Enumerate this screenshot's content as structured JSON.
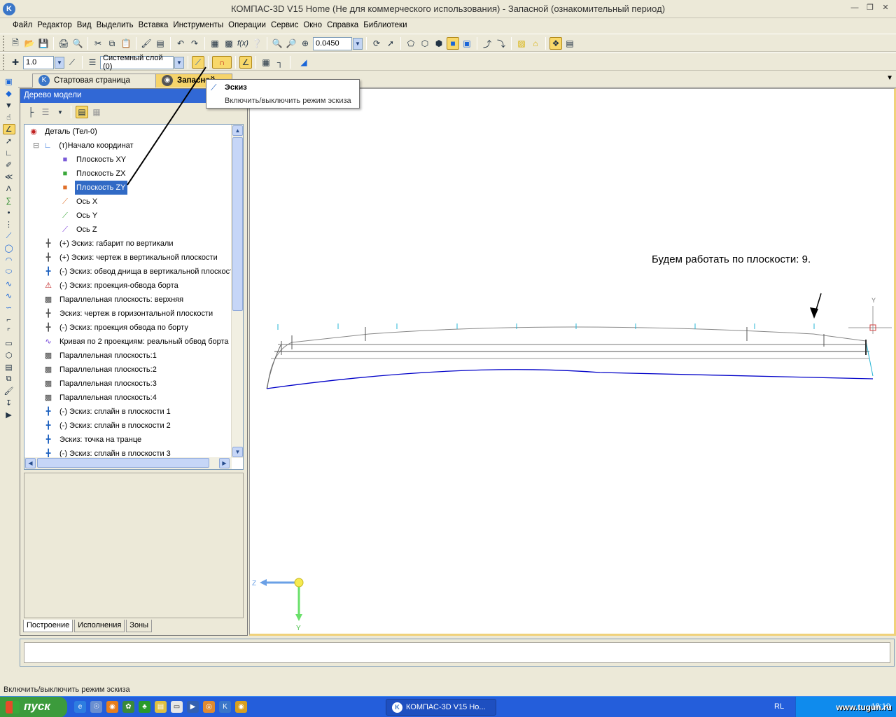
{
  "window": {
    "title": "КОМПАС-3D V15 Home (Не для коммерческого использования) - Запасной (ознакомительный период)"
  },
  "menu": [
    "Файл",
    "Редактор",
    "Вид",
    "Выделить",
    "Вставка",
    "Инструменты",
    "Операции",
    "Сервис",
    "Окно",
    "Справка",
    "Библиотеки"
  ],
  "toolbar": {
    "zoom_value": "0.0450",
    "step_value": "1.0",
    "layer_value": "Системный слой (0)"
  },
  "tabs": {
    "start_page": "Стартовая страница",
    "document": "Запасной"
  },
  "tree_panel": {
    "title": "Дерево модели",
    "rows": [
      {
        "label": "Деталь (Тел-0)",
        "indent": 0,
        "icon": "part-error-icon"
      },
      {
        "label": "(т)Начало координат",
        "indent": 1,
        "icon": "origin-icon"
      },
      {
        "label": "Плоскость XY",
        "indent": 2,
        "icon": "plane-xy-icon"
      },
      {
        "label": "Плоскость ZX",
        "indent": 2,
        "icon": "plane-zx-icon"
      },
      {
        "label": "Плоскость ZY",
        "indent": 2,
        "icon": "plane-zy-icon",
        "selected": true
      },
      {
        "label": "Ось X",
        "indent": 2,
        "icon": "axis-x-icon"
      },
      {
        "label": "Ось Y",
        "indent": 2,
        "icon": "axis-y-icon"
      },
      {
        "label": "Ось Z",
        "indent": 2,
        "icon": "axis-z-icon"
      },
      {
        "label": "(+) Эскиз: габарит по вертикали",
        "indent": 1,
        "icon": "sketch-gray-icon"
      },
      {
        "label": "(+) Эскиз: чертеж в вертикальной плоскости",
        "indent": 1,
        "icon": "sketch-gray-icon"
      },
      {
        "label": "(-) Эскиз: обвод днища в вертикальной плоскости",
        "indent": 1,
        "icon": "sketch-blue-icon"
      },
      {
        "label": "(-) Эскиз: проекция-обвода борта",
        "indent": 1,
        "icon": "sketch-error-icon"
      },
      {
        "label": "Параллельная плоскость: верхняя",
        "indent": 1,
        "icon": "plane-gray-icon"
      },
      {
        "label": "Эскиз: чертеж в горизонтальной плоскости",
        "indent": 1,
        "icon": "sketch-gray-icon"
      },
      {
        "label": "(-) Эскиз: проекция обвода по борту",
        "indent": 1,
        "icon": "sketch-gray-icon"
      },
      {
        "label": "Кривая по 2 проекциям: реальный обвод борта",
        "indent": 1,
        "icon": "curve-icon"
      },
      {
        "label": "Параллельная плоскость:1",
        "indent": 1,
        "icon": "plane-gray-icon"
      },
      {
        "label": "Параллельная плоскость:2",
        "indent": 1,
        "icon": "plane-gray-icon"
      },
      {
        "label": "Параллельная плоскость:3",
        "indent": 1,
        "icon": "plane-gray-icon"
      },
      {
        "label": "Параллельная плоскость:4",
        "indent": 1,
        "icon": "plane-gray-icon"
      },
      {
        "label": "(-) Эскиз: сплайн в плоскости 1",
        "indent": 1,
        "icon": "sketch-blue-icon"
      },
      {
        "label": "(-) Эскиз: сплайн в плоскости 2",
        "indent": 1,
        "icon": "sketch-blue-icon"
      },
      {
        "label": "Эскиз: точка на транце",
        "indent": 1,
        "icon": "sketch-blue-icon"
      },
      {
        "label": "(-) Эскиз: сплайн в плоскости 3",
        "indent": 1,
        "icon": "sketch-blue-icon"
      }
    ],
    "bottom_tabs": [
      "Построение",
      "Исполнения",
      "Зоны"
    ]
  },
  "tooltip": {
    "title": "Эскиз",
    "description": "Включить/выключить режим эскиза"
  },
  "viewport": {
    "annotation": "Будем работать по плоскости: 9.",
    "axis_y_label": "Y",
    "axis_z_label": "Z",
    "axis_y_label_top": "Y"
  },
  "status": {
    "text": "Включить/выключить режим эскиза"
  },
  "taskbar": {
    "start_label": "пуск",
    "task_button": "КОМПАС-3D V15 Ho...",
    "lang": "RL",
    "clock": "18:10",
    "watermark": "www.tugun.ru"
  },
  "colors": {
    "accent_blue": "#3168d5",
    "highlight_tab": "#f6d46a",
    "curve_blue": "#0000c8"
  }
}
